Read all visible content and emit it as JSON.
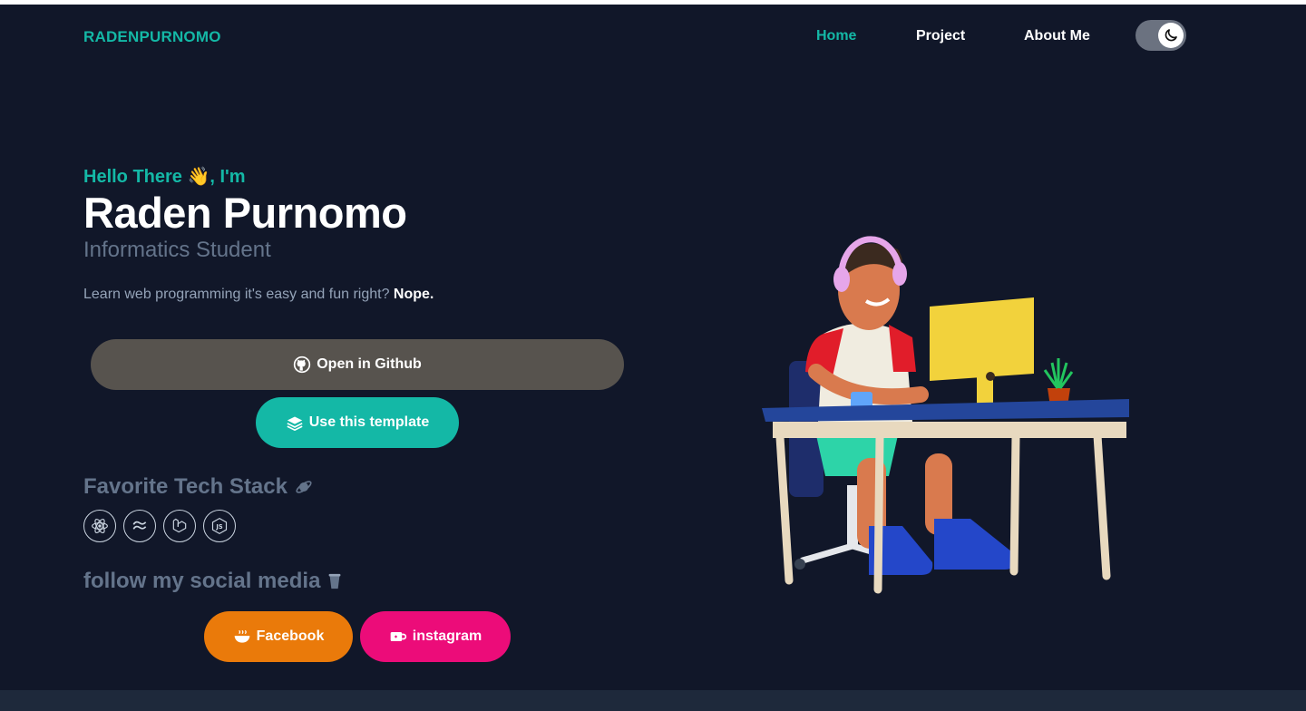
{
  "nav": {
    "brand": "RADENPURNOMO",
    "links": [
      {
        "label": "Home",
        "active": true
      },
      {
        "label": "Project",
        "active": false
      },
      {
        "label": "About Me",
        "active": false
      }
    ],
    "theme_toggle_icon": "moon-icon"
  },
  "hero": {
    "greeting": "Hello There 👋, I'm",
    "name": "Raden Purnomo",
    "role": "Informatics Student",
    "tagline": "Learn web programming it's easy and fun right?",
    "tagline_emphasis": "Nope."
  },
  "buttons": {
    "github": "Open in Github",
    "template": "Use this template",
    "facebook": "Facebook",
    "instagram": "instagram"
  },
  "tech_stack": {
    "title": "Favorite Tech Stack",
    "icons": [
      "react-icon",
      "tailwind-icon",
      "laravel-icon",
      "nodejs-icon"
    ]
  },
  "social": {
    "title": "follow my social media"
  },
  "colors": {
    "background": "#111729",
    "accent": "#14b8a6",
    "github_button": "#57534e",
    "facebook_button": "#ea7a0a",
    "instagram_button": "#ec0c79"
  }
}
